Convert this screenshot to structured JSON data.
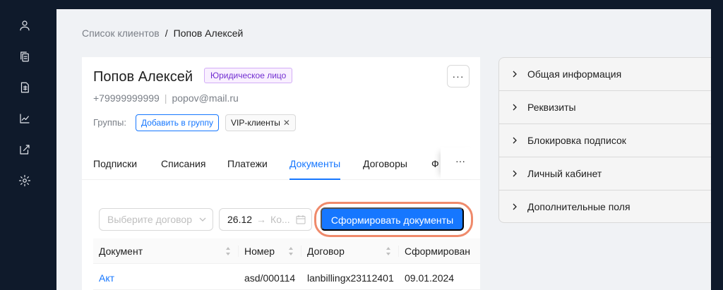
{
  "sidebar": {
    "icons": [
      "user-icon",
      "copy-icon",
      "document-icon",
      "chart-icon",
      "edit-icon",
      "gear-icon"
    ]
  },
  "breadcrumb": {
    "parent": "Список клиентов",
    "separator": "/",
    "current": "Попов Алексей"
  },
  "client": {
    "name": "Попов Алексей",
    "type_badge": "Юридическое лицо",
    "phone": "+79999999999",
    "contact_divider": "|",
    "email": "popov@mail.ru",
    "more_label": "···",
    "groups_label": "Группы:",
    "add_group_label": "Добавить в группу",
    "group_tag": "VIP-клиенты",
    "group_tag_close": "✕"
  },
  "tabs": {
    "items": [
      "Подписки",
      "Списания",
      "Платежи",
      "Документы",
      "Договоры",
      "Ф"
    ],
    "active": "Документы",
    "more_label": "···"
  },
  "filters": {
    "contract_placeholder": "Выберите договор",
    "date_start": "26.12",
    "date_arrow": "→",
    "date_end_placeholder": "Ко...",
    "generate_label": "Сформировать документы"
  },
  "table": {
    "columns": [
      "Документ",
      "Номер",
      "Договор",
      "Сформирован"
    ],
    "rows": [
      {
        "document": "Акт",
        "number": "asd/000114",
        "contract": "lanbillingx23112401",
        "created": "09.01.2024"
      }
    ]
  },
  "info_panel": {
    "items": [
      "Общая информация",
      "Реквизиты",
      "Блокировка подписок",
      "Личный кабинет",
      "Дополнительные поля"
    ]
  },
  "colors": {
    "sidebar_bg": "#0f1a2b",
    "accent": "#1677ff",
    "badge_purple": "#722ed1",
    "highlight_ring": "#ef8a6b"
  }
}
